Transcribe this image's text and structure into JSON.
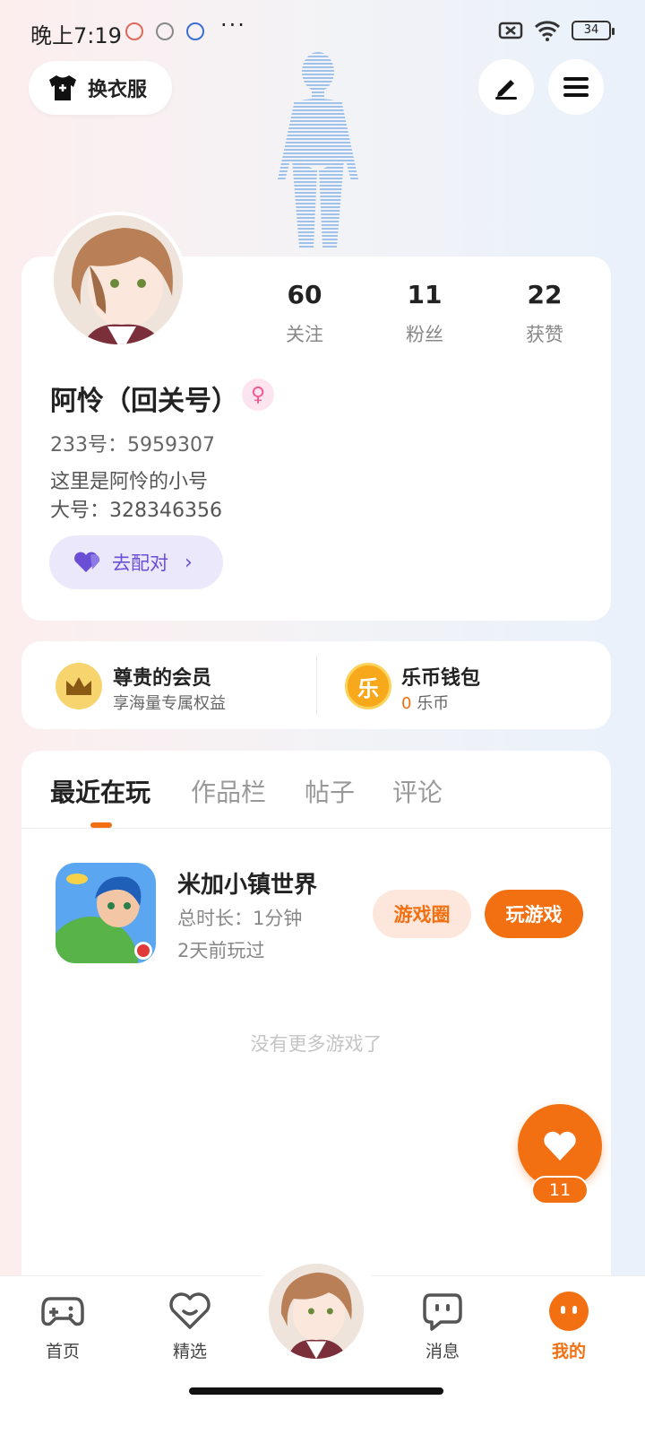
{
  "status": {
    "time": "晚上7:19",
    "more": "···",
    "battery": "34"
  },
  "header": {
    "outfit_label": "换衣服"
  },
  "profile": {
    "stats": [
      {
        "num": "60",
        "label": "关注"
      },
      {
        "num": "11",
        "label": "粉丝"
      },
      {
        "num": "22",
        "label": "获赞"
      }
    ],
    "name": "阿怜（回关号）",
    "gender_symbol": "♀",
    "id_line": "233号：5959307",
    "bio_line1": "这里是阿怜的小号",
    "bio_line2": "大号：328346356",
    "pair_label": "去配对"
  },
  "member": {
    "vip_title": "尊贵的会员",
    "vip_sub": "享海量专属权益",
    "wallet_title": "乐币钱包",
    "wallet_num": "0",
    "wallet_unit": "乐币",
    "coin_char": "乐"
  },
  "tabs": [
    "最近在玩",
    "作品栏",
    "帖子",
    "评论"
  ],
  "game": {
    "name": "米加小镇世界",
    "duration": "总时长：1分钟",
    "last_played": "2天前玩过",
    "circle_label": "游戏圈",
    "play_label": "玩游戏"
  },
  "no_more": "没有更多游戏了",
  "like": {
    "count": "11"
  },
  "nav": {
    "items": [
      {
        "label": "首页"
      },
      {
        "label": "精选"
      },
      {
        "label": "消息"
      },
      {
        "label": "我的"
      }
    ]
  },
  "colors": {
    "accent": "#f37012",
    "pair": "#6a4fd6",
    "gender": "#f05a91"
  }
}
